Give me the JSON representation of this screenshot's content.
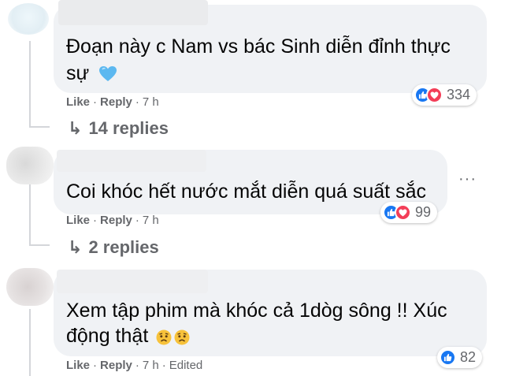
{
  "comments": [
    {
      "text_line1": "Đoạn này c Nam vs bác Sinh diễn đỉnh thực",
      "text_line2": "sự",
      "like_label": "Like",
      "reply_label": "Reply",
      "time": "7 h",
      "reaction_count": "334",
      "replies_label": "14 replies"
    },
    {
      "text_line1": "Coi khóc hết nước mắt diễn quá suất sắc",
      "like_label": "Like",
      "reply_label": "Reply",
      "time": "7 h",
      "reaction_count": "99",
      "replies_label": "2 replies",
      "more_label": "···"
    },
    {
      "text_line1": "Xem tập phim mà khóc cả 1dòg sông !! Xúc",
      "text_line2": "động thật",
      "like_label": "Like",
      "reply_label": "Reply",
      "time": "7 h",
      "edited_label": "Edited",
      "reaction_count": "82"
    }
  ],
  "separator": "·",
  "reply_arrow": "↳",
  "colors": {
    "bubble": "#f0f2f5",
    "meta_text": "#65676b",
    "like_blue": "#1877f2",
    "love_red": "#f33e58"
  }
}
